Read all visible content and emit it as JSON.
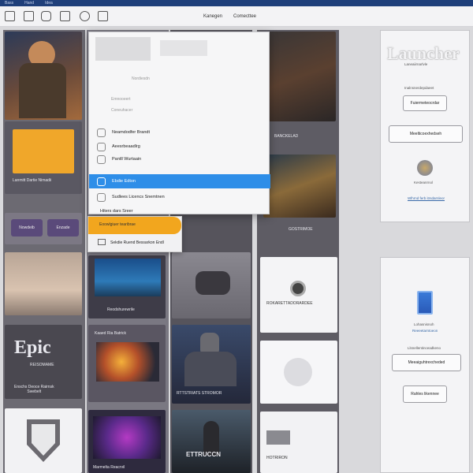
{
  "menubar": [
    "Bass",
    "Hand",
    "Idea"
  ],
  "toolbar": {
    "icons": [
      "crop-icon",
      "file-icon",
      "image-icon",
      "picture-icon",
      "disc-icon",
      "window-icon"
    ],
    "labels": [
      "Kanegen",
      "Comecttee"
    ]
  },
  "grid": {
    "tiles": [
      {
        "name": "hero-soldier",
        "label": ""
      },
      {
        "name": "yellow-card",
        "label": "Lanmitt Dartie Nimadii"
      },
      {
        "name": "button-pair",
        "labels": [
          "Nowdeib",
          "Enzade"
        ]
      },
      {
        "name": "sunset-tile",
        "label": ""
      },
      {
        "name": "epic-logo",
        "title": "Epic",
        "subtitle": "REISOMAME",
        "caption": "Enschs Deoce Rairnsk\nSwebelt"
      },
      {
        "name": "shield-tile",
        "label": ""
      }
    ],
    "middle": [
      {
        "name": "underwater-tile",
        "label": "Reodshurewrile"
      },
      {
        "name": "fire-tile",
        "label": "Kaaed Ria Batrick"
      },
      {
        "name": "purple-tile",
        "label": "Marmelta Reacrvil"
      }
    ],
    "third": [
      {
        "name": "mech-tile",
        "label": ""
      },
      {
        "name": "armored-soldier",
        "label": "RTTSTRIATS STROMOR"
      },
      {
        "name": "hooded-figure",
        "label": "ETTRUCCN"
      }
    ],
    "fourth": [
      {
        "name": "dragon-tile",
        "label": "BANCKELAD"
      },
      {
        "name": "cave-tile",
        "label": "GOSTRIMOE"
      },
      {
        "name": "camera-tile",
        "label": "ROKARETTADORARDEE"
      },
      {
        "name": "white-gear-tile",
        "label": ""
      },
      {
        "name": "sofa-tile",
        "label": "HOTRIRON"
      }
    ]
  },
  "popup": {
    "header_rows": [
      "Nordiesdn",
      "Emnooeert",
      "Coneuhacer"
    ],
    "items": [
      {
        "label": "Neamdodfer Brandt",
        "selected": false
      },
      {
        "label": "Aeesrbeaadlrg",
        "selected": false
      },
      {
        "label": "Pantll Wurtaain",
        "selected": false
      },
      {
        "label": "Ebdie Edton",
        "selected": true
      },
      {
        "label": "Sudlees Licencs Snemtnen",
        "selected": false
      },
      {
        "label": "Hiters dars Sreer",
        "selected": false
      }
    ],
    "submenu": {
      "highlight": "Eoowlgiuer tearibrae",
      "row": "Sekdie Ruend Bessarkon Endl"
    }
  },
  "launcher_panel": {
    "title": "Launcher",
    "subtitle": "Laneaiirnarlvle",
    "caption": "Inalnsnerdepdaeet",
    "button1": "Fuiermeteocrdar",
    "button2": "Meelticoexhedseh",
    "app_name": "Kesteanrnol",
    "link": "Wlhrnd ferb itrsdarnleor"
  },
  "lower_panel": {
    "app_name": "Lohasnisnoh",
    "app_sub": "Reeeetarntoeon",
    "caption": "Llsnellentinceadkeno",
    "button1": "Meeaiguhtrexcheded",
    "button2": "Rahles likennee"
  }
}
